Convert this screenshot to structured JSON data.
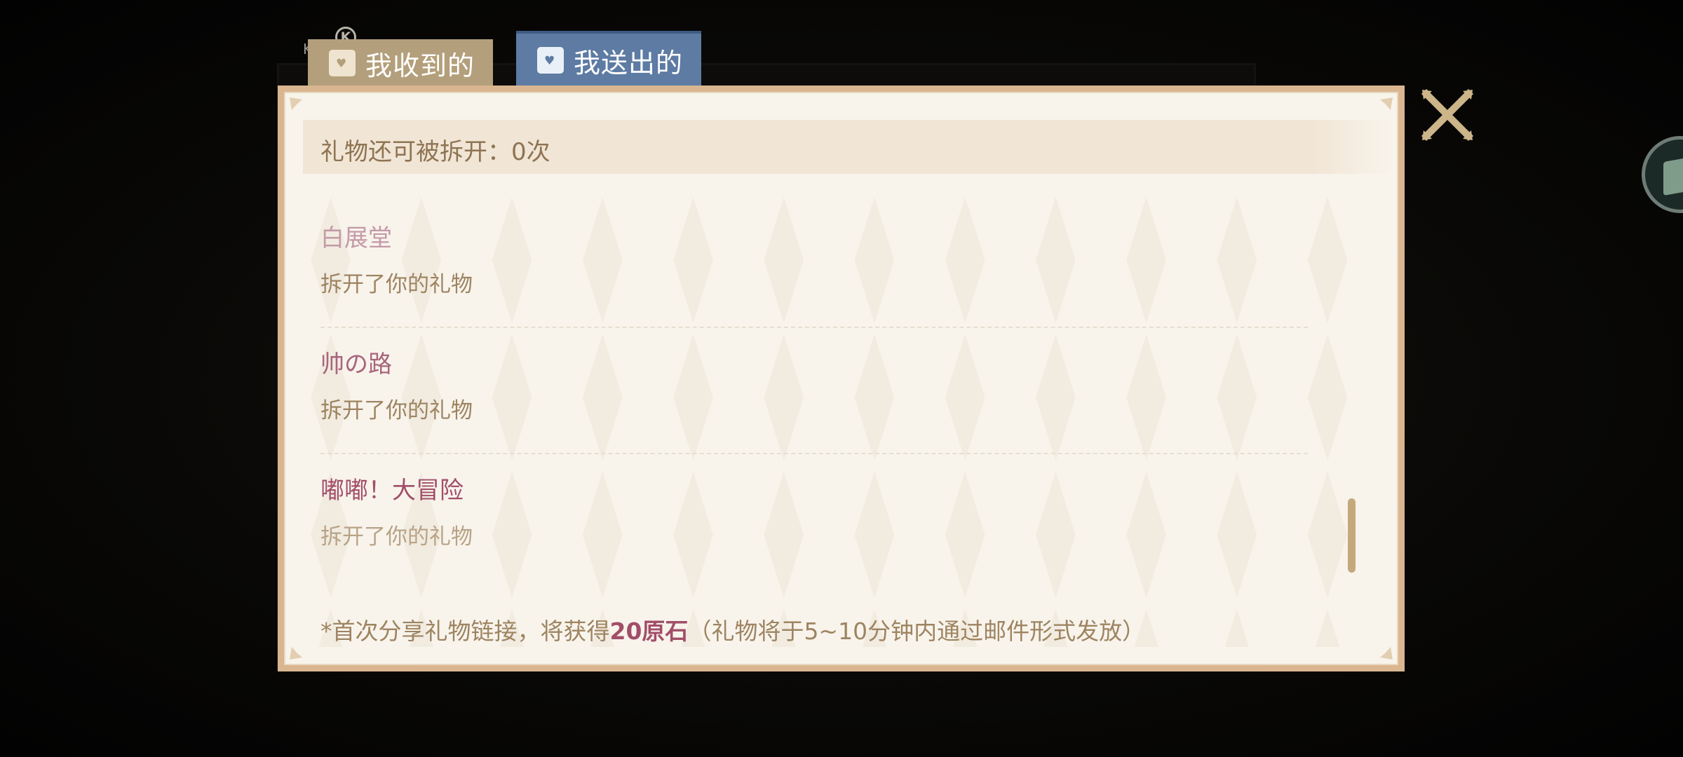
{
  "status": {
    "speed_label": "K/s",
    "speed_icon_letter": "K"
  },
  "tabs": [
    {
      "label": "我收到的",
      "icon": "envelope-heart-icon",
      "active": false,
      "color": "#b39f7b"
    },
    {
      "label": "我送出的",
      "icon": "envelope-heart-icon",
      "active": true,
      "color": "#5d7ba3"
    }
  ],
  "panel": {
    "notice": "礼物还可被拆开：0次",
    "entries": [
      {
        "name": "白展堂",
        "action": "拆开了你的礼物"
      },
      {
        "name": "帅の路",
        "action": "拆开了你的礼物"
      },
      {
        "name": "嘟嘟！大冒险",
        "action": "拆开了你的礼物"
      }
    ],
    "footer": {
      "before": "*首次分享礼物链接，将获得",
      "reward": "20原石",
      "after": "（礼物将于5~10分钟内通过邮件形式发放）"
    }
  },
  "icons": {
    "close": "close-x-icon",
    "side": "book-icon"
  },
  "colors": {
    "panel_bg": "#f8f4ec",
    "panel_border": "#d9b690",
    "name_accent": "#a24e69",
    "text_brown": "#9e8461"
  }
}
